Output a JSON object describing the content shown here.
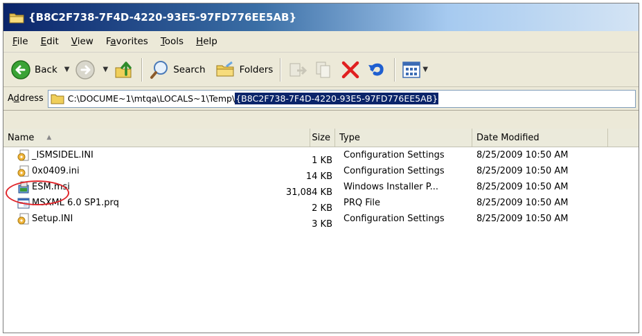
{
  "window": {
    "title": "{B8C2F738-7F4D-4220-93E5-97FD776EE5AB}"
  },
  "menu": [
    {
      "label": "File",
      "name": "menu-file"
    },
    {
      "label": "Edit",
      "name": "menu-edit"
    },
    {
      "label": "View",
      "name": "menu-view"
    },
    {
      "label": "Favorites",
      "name": "menu-favorites"
    },
    {
      "label": "Tools",
      "name": "menu-tools"
    },
    {
      "label": "Help",
      "name": "menu-help"
    }
  ],
  "toolbar": {
    "back_label": "Back",
    "search_label": "Search",
    "folders_label": "Folders"
  },
  "address": {
    "label": "Address",
    "path_prefix": "C:\\DOCUME~1\\mtqa\\LOCALS~1\\Temp\\",
    "path_selected": "{B8C2F738-7F4D-4220-93E5-97FD776EE5AB}"
  },
  "columns": {
    "name": "Name",
    "size": "Size",
    "type": "Type",
    "date": "Date Modified"
  },
  "files": [
    {
      "name": "_ISMSIDEL.INI",
      "size": "1 KB",
      "type": "Configuration Settings",
      "date": "8/25/2009 10:50 AM",
      "icon": "ini-settings-icon"
    },
    {
      "name": "0x0409.ini",
      "size": "14 KB",
      "type": "Configuration Settings",
      "date": "8/25/2009 10:50 AM",
      "icon": "ini-settings-icon"
    },
    {
      "name": "ESM.msi",
      "size": "31,084 KB",
      "type": "Windows Installer P...",
      "date": "8/25/2009 10:50 AM",
      "icon": "msi-installer-icon"
    },
    {
      "name": "MSXML 6.0 SP1.prq",
      "size": "2 KB",
      "type": "PRQ File",
      "date": "8/25/2009 10:50 AM",
      "icon": "prq-file-icon"
    },
    {
      "name": "Setup.INI",
      "size": "3 KB",
      "type": "Configuration Settings",
      "date": "8/25/2009 10:50 AM",
      "icon": "ini-settings-icon"
    }
  ],
  "colors": {
    "title_gradient_start": "#0a246a",
    "selection": "#0a246a",
    "annotation_circle": "#e0262b"
  }
}
